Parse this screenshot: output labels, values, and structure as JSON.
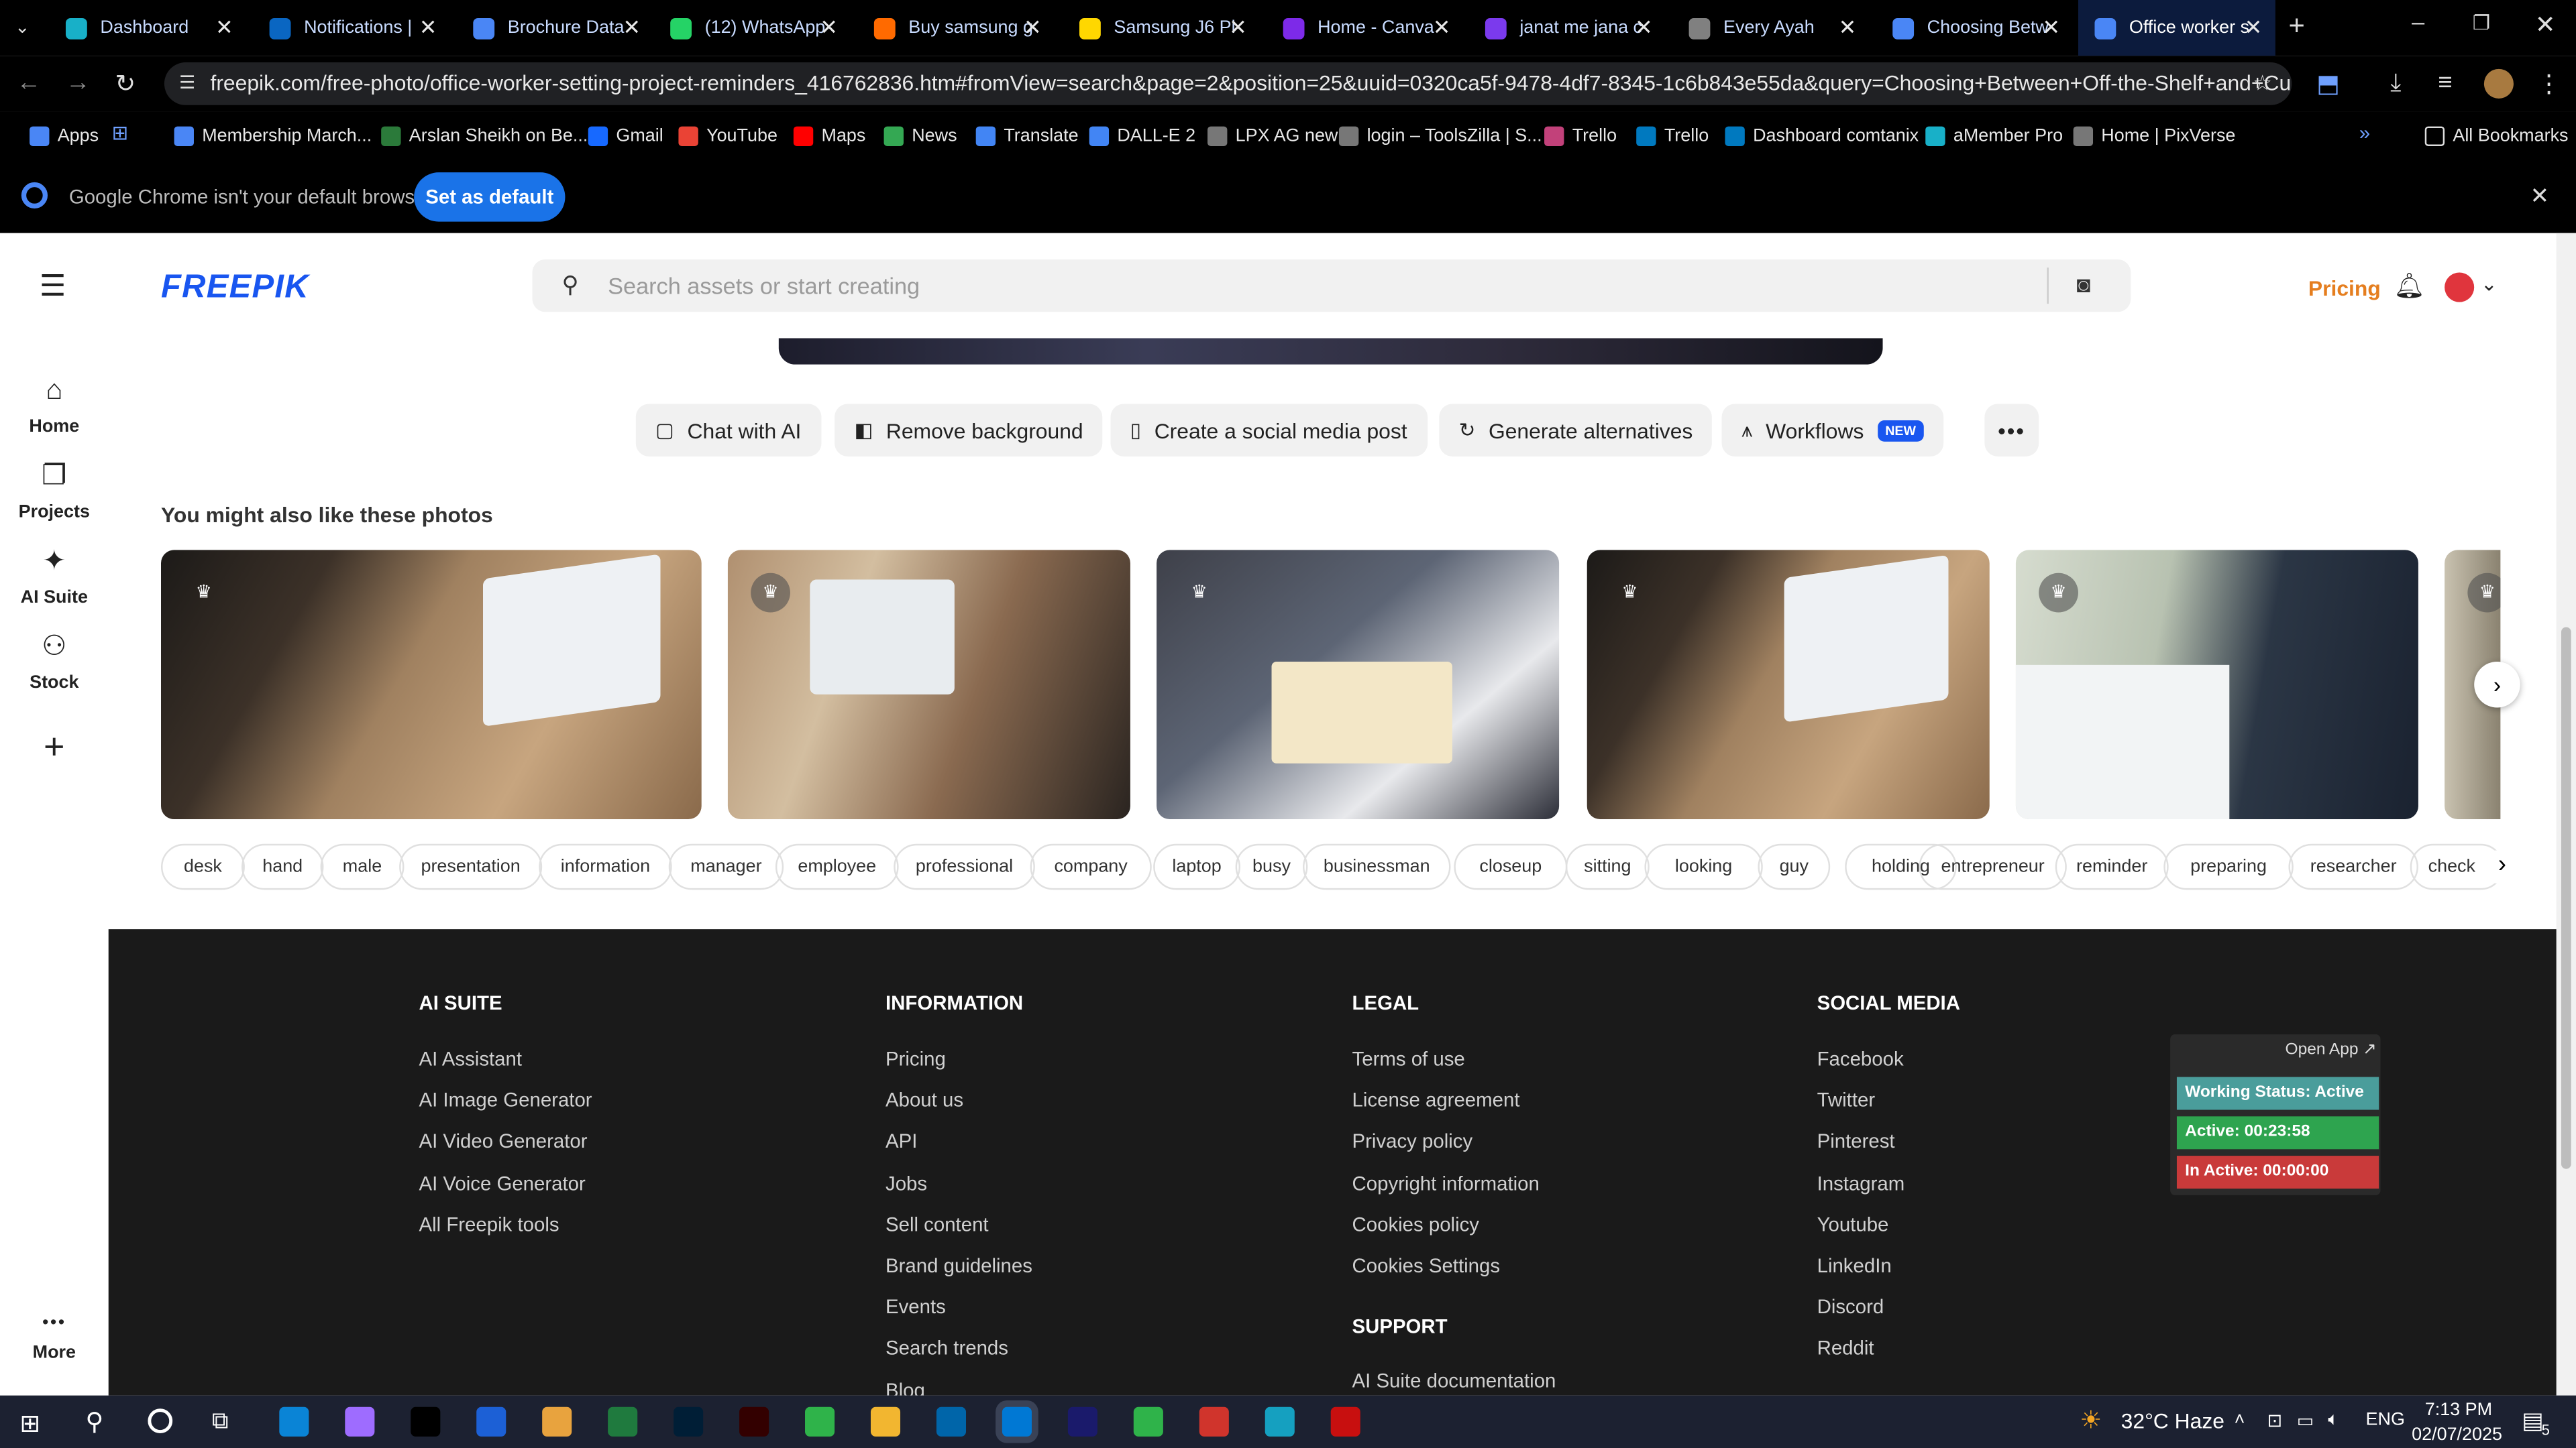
{
  "browser": {
    "tabs": [
      {
        "title": "Dashboard",
        "color": "#18b0c8"
      },
      {
        "title": "Notifications |",
        "color": "#0a66c2"
      },
      {
        "title": "Brochure Data",
        "color": "#4a86f5"
      },
      {
        "title": "(12) WhatsApp",
        "color": "#25d366"
      },
      {
        "title": "Buy samsung g",
        "color": "#ff6a00"
      },
      {
        "title": "Samsung J6 Pl",
        "color": "#ffd700"
      },
      {
        "title": "Home - Canva",
        "color": "#7d2ae8"
      },
      {
        "title": "janat me jana c",
        "color": "#7b3aed"
      },
      {
        "title": "Every Ayah",
        "color": "#808080"
      },
      {
        "title": "Choosing Betw",
        "color": "#4a86f5"
      },
      {
        "title": "Office worker s",
        "color": "#4a86f5"
      }
    ],
    "url": "freepik.com/free-photo/office-worker-setting-project-reminders_416762836.htm#fromView=search&page=2&position=25&uuid=0320ca5f-9478-4df7-8345-1c6b843e55da&query=Choosing+Between+Off-the-Shelf+and+Custom+Web+Platf...",
    "bookmarks": [
      "Apps",
      "Membership March...",
      "Arslan Sheikh on Be...",
      "Gmail",
      "YouTube",
      "Maps",
      "News",
      "Translate",
      "DALL-E 2",
      "LPX AG new",
      "login – ToolsZilla | S...",
      "Trello",
      "Trello",
      "Dashboard comtanix",
      "aMember Pro",
      "Home | PixVerse"
    ],
    "all_bookmarks": "All Bookmarks",
    "infobar": {
      "message": "Google Chrome isn't your default browser",
      "button": "Set as default"
    }
  },
  "sidebar": {
    "items": [
      {
        "label": "Home",
        "icon": "home-icon",
        "glyph": "⌂"
      },
      {
        "label": "Projects",
        "icon": "projects-icon",
        "glyph": "❐"
      },
      {
        "label": "AI Suite",
        "icon": "ai-suite-icon",
        "glyph": "✦"
      },
      {
        "label": "Stock",
        "icon": "stock-icon",
        "glyph": "⚇"
      }
    ],
    "add_glyph": "+",
    "more_label": "More",
    "more_glyph": "•••"
  },
  "header": {
    "logo": "FREEPIK",
    "search_placeholder": "Search assets or start creating",
    "pricing": "Pricing"
  },
  "actions": [
    {
      "label": "Chat with AI",
      "glyph": "▢"
    },
    {
      "label": "Remove background",
      "glyph": "◧"
    },
    {
      "label": "Create a social media post",
      "glyph": "▯"
    },
    {
      "label": "Generate alternatives",
      "glyph": "↻"
    },
    {
      "label": "Workflows",
      "glyph": "⩚",
      "badge": "NEW"
    }
  ],
  "related": {
    "title": "You might also like these photos"
  },
  "tags": [
    "desk",
    "hand",
    "male",
    "presentation",
    "information",
    "manager",
    "employee",
    "professional",
    "company",
    "laptop",
    "busy",
    "businessman",
    "closeup",
    "sitting",
    "looking",
    "guy",
    "holding",
    "entrepreneur",
    "reminder",
    "preparing",
    "researcher",
    "check"
  ],
  "footer": {
    "columns": [
      {
        "heading": "AI SUITE",
        "links": [
          "AI Assistant",
          "AI Image Generator",
          "AI Video Generator",
          "AI Voice Generator",
          "All Freepik tools"
        ]
      },
      {
        "heading": "INFORMATION",
        "links": [
          "Pricing",
          "About us",
          "API",
          "Jobs",
          "Sell content",
          "Brand guidelines",
          "Events",
          "Search trends",
          "Blog"
        ]
      },
      {
        "heading": "LEGAL",
        "links": [
          "Terms of use",
          "License agreement",
          "Privacy policy",
          "Copyright information",
          "Cookies policy",
          "Cookies Settings"
        ]
      },
      {
        "heading": "SOCIAL MEDIA",
        "links": [
          "Facebook",
          "Twitter",
          "Pinterest",
          "Instagram",
          "Youtube",
          "LinkedIn",
          "Discord",
          "Reddit"
        ]
      }
    ],
    "support_heading": "SUPPORT",
    "support_links": [
      "AI Suite documentation"
    ]
  },
  "tracker": {
    "open_app": "Open App ↗",
    "status": "Working Status: Active",
    "active": "Active: 00:23:58",
    "inactive": "In Active: 00:00:00"
  },
  "taskbar": {
    "weather": "32°C  Haze",
    "lang": "ENG",
    "time": "7:13 PM",
    "date": "02/07/2025",
    "notif_count": "5"
  }
}
